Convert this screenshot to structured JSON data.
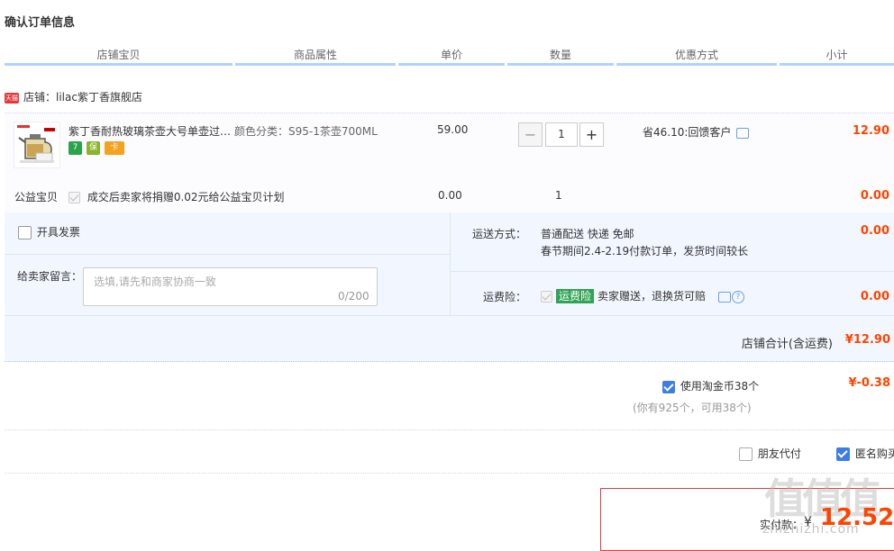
{
  "page_title": "确认订单信息",
  "columns": [
    "店铺宝贝",
    "商品属性",
    "单价",
    "数量",
    "优惠方式",
    "小计"
  ],
  "shop": {
    "badge": "天猫",
    "label": "店铺：lilac紫丁香旗舰店"
  },
  "item": {
    "title": "紫丁香耐热玻璃茶壶大号单壶过…",
    "services": [
      "7",
      "保",
      "卡"
    ],
    "attribute": "颜色分类：S95-1茶壶700ML",
    "unit_price": "59.00",
    "quantity": "1",
    "minus": "−",
    "plus": "+",
    "discount": "省46.10:回馈客户",
    "subtotal": "12.90"
  },
  "charity": {
    "label": "公益宝贝",
    "text": "成交后卖家将捐赠0.02元给公益宝贝计划",
    "price": "0.00",
    "qty": "1",
    "subtotal": "0.00"
  },
  "invoice": {
    "label": "开具发票"
  },
  "message": {
    "label": "给卖家留言：",
    "placeholder": "选填,请先和商家协商一致",
    "count": "0/200"
  },
  "shipping": {
    "label": "运送方式：",
    "value": "普通配送 快递 免邮",
    "note": "春节期间2.4-2.19付款订单，发货时间较长",
    "price": "0.00"
  },
  "insurance": {
    "label": "运费险：",
    "tag": "运费险",
    "text": "卖家赠送，退换货可赔",
    "price": "0.00"
  },
  "shop_total": {
    "label": "店铺合计(含运费)",
    "value": "¥12.90"
  },
  "coins": {
    "label": "使用淘金币38个",
    "value": "¥-0.38",
    "note": "(你有925个，可用38个)"
  },
  "friend_pay": {
    "label": "朋友代付"
  },
  "anonymous": {
    "label": "匿名购买"
  },
  "payment": {
    "label": "实付款：",
    "currency": "¥",
    "amount": "12.52"
  },
  "watermark": {
    "text": "值值值",
    "url": "zhizhizhi.com"
  },
  "colors": {
    "accent": "#ff4400",
    "checkbox": "#3c7de6",
    "header_line": "#b2d1ff",
    "insurance_tag": "#31a354"
  }
}
